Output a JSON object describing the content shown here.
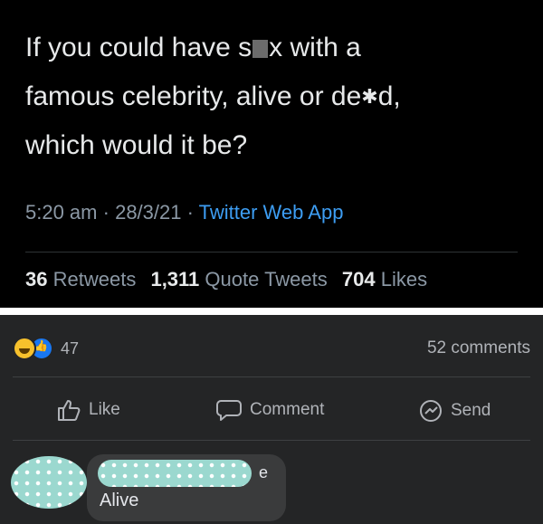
{
  "tweet": {
    "text_line1_a": "If you could have s",
    "text_line1_b": "x with a",
    "text_line2_a": "famous celebrity, alive or de",
    "text_line2_b": "d,",
    "text_line3": "which would it be?",
    "time": "5:20 am",
    "sep": "·",
    "date": "28/3/21",
    "app": "Twitter Web App",
    "retweets_count": "36",
    "retweets_label": "Retweets",
    "quotes_count": "1,311",
    "quotes_label": "Quote Tweets",
    "likes_count": "704",
    "likes_label": "Likes"
  },
  "facebook": {
    "reaction_count": "47",
    "comments_count": "52 comments",
    "actions": {
      "like": "Like",
      "comment": "Comment",
      "send": "Send"
    },
    "comment": {
      "name_tail": "e",
      "text": "Alive"
    }
  },
  "icons": [
    "haha-reaction-icon",
    "like-reaction-icon",
    "thumbs-up-icon",
    "comment-bubble-icon",
    "messenger-icon",
    "censor-splat-icon"
  ],
  "colors": {
    "twitter_link": "#3d9df2",
    "fb_bg": "#242526",
    "fb_blue": "#1877f2",
    "haha_yellow": "#f7c12c",
    "blur_teal": "#9bd8cf"
  }
}
